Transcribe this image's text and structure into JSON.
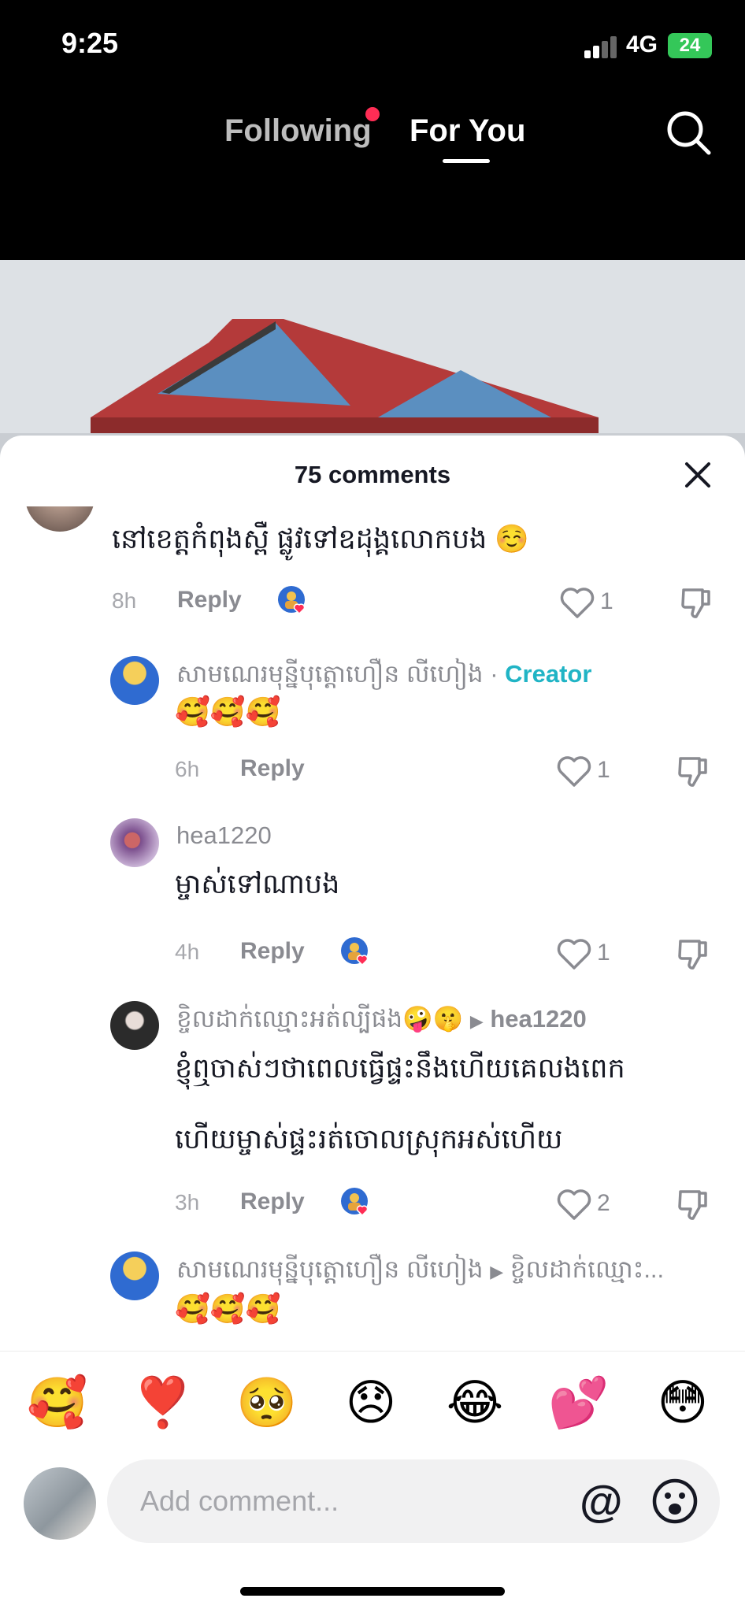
{
  "status": {
    "time": "9:25",
    "network": "4G",
    "battery": "24"
  },
  "nav": {
    "following": "Following",
    "for_you": "For You"
  },
  "sheet": {
    "title": "75 comments"
  },
  "comments": [
    {
      "text": "នៅខេត្តកំពុងស្ពឺ ផ្លូវទៅឧដុង្គលោកបង ☺️",
      "time": "8h",
      "reply": "Reply",
      "likes": "1"
    },
    {
      "user": "សាមណេរមុន្នីបុត្តោហឿន លីហៀង",
      "sep": " · ",
      "badge": "Creator",
      "text": "🥰🥰🥰",
      "time": "6h",
      "reply": "Reply",
      "likes": "1"
    },
    {
      "user": "hea1220",
      "text": "ម្ចាស់ទៅណាបង",
      "time": "4h",
      "reply": "Reply",
      "likes": "1"
    },
    {
      "user": "ខ្ចិលដាក់ឈ្មោះអត់ល្បីផង🤪🤫",
      "reply_to": "hea1220",
      "text_line1": "ខ្ញុំឮចាស់ៗថាពេលធ្វើផ្ទះនឹងហើយគេលងពេក",
      "text_line2": "ហើយម្ចាស់ផ្ទះរត់ចោលស្រុកអស់ហើយ",
      "time": "3h",
      "reply": "Reply",
      "likes": "2"
    },
    {
      "user": "សាមណេរមុន្នីបុត្តោហឿន លីហៀង",
      "reply_to": "ខ្ចិលដាក់ឈ្មោះ...",
      "text": "🥰🥰🥰"
    }
  ],
  "emoji_bar": [
    "🥰",
    "❣️",
    "🥺",
    "😞",
    "😂",
    "💕",
    "😳"
  ],
  "input": {
    "placeholder": "Add comment...",
    "at": "@"
  }
}
